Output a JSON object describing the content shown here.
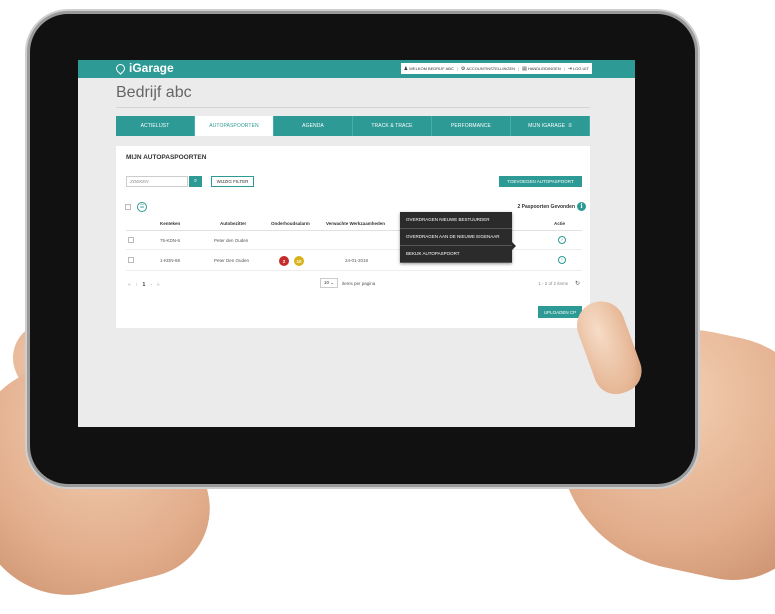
{
  "app": {
    "logo": "iGarage",
    "userbar": [
      {
        "icon": "user-icon",
        "glyph": "♟",
        "label": "WELKOM BEDRIJF ABC"
      },
      {
        "icon": "gear-icon",
        "glyph": "⚙",
        "label": "ACCOUNTINSTELLINGEN"
      },
      {
        "icon": "book-icon",
        "glyph": "▤",
        "label": "HANDLEIDINGEN"
      },
      {
        "icon": "logout-icon",
        "glyph": "⇥",
        "label": "LOG UIT"
      }
    ],
    "separator": "|"
  },
  "page": {
    "title": "Bedrijf abc"
  },
  "tabs": [
    {
      "label": "ACTIELIJST",
      "active": false
    },
    {
      "label": "AUTOPASPOORTEN",
      "active": true
    },
    {
      "label": "AGENDA",
      "active": false
    },
    {
      "label": "TRACK & TRACE",
      "active": false
    },
    {
      "label": "PERFORMANCE",
      "active": false
    },
    {
      "label": "MIJN IGARAGE",
      "active": false,
      "icon": "≡"
    }
  ],
  "card": {
    "title": "MIJN AUTOPASPOORTEN",
    "search_placeholder": "ZOEKEN",
    "search_icon": "⌕",
    "filter_label": "WIJZIG FILTER",
    "add_label": "TOEVOEGEN AUTOPASPOORT",
    "list_icon": "☰",
    "found_text": "2 Paspoorten Gevonden",
    "info_icon": "i",
    "upload_label": "UPLOADEN CP"
  },
  "table": {
    "headers": [
      "Kenteken",
      "Autobezitter",
      "Onderhoudsalarm",
      "Verwachte Werkzaamheden",
      "Laatste Be",
      "Actie"
    ],
    "rows": [
      {
        "kenteken": "75-KDN-6",
        "eigenaar": "Peter den Ouden",
        "alarms": [],
        "werkzaamheden": "",
        "action_icon": "›"
      },
      {
        "kenteken": "1-KDN-68",
        "eigenaar": "Peter Den Ouden",
        "alarms": [
          {
            "value": "2",
            "color": "#c62b2b"
          },
          {
            "value": "10",
            "color": "#d9b21a"
          }
        ],
        "werkzaamheden": "24-01-2018",
        "action_icon": "›"
      }
    ]
  },
  "pagination": {
    "first": "«",
    "prev": "‹",
    "current": "1",
    "next": "›",
    "last": "»",
    "per_page": "10 ⌄",
    "per_page_label": "items per pagina",
    "count": "1 - 2 of 2 items",
    "refresh_icon": "↻"
  },
  "context_menu": [
    "OVERDRAGEN NIEUWE BESTUURDER",
    "OVERDRAGEN AAN DE NIEUWE EIGENAAR",
    "BEKIJK AUTOPASPOORT"
  ],
  "colors": {
    "accent": "#2e9a95",
    "menu_bg": "#2b2b2b",
    "alarm_red": "#c62b2b",
    "alarm_yellow": "#d9b21a"
  }
}
